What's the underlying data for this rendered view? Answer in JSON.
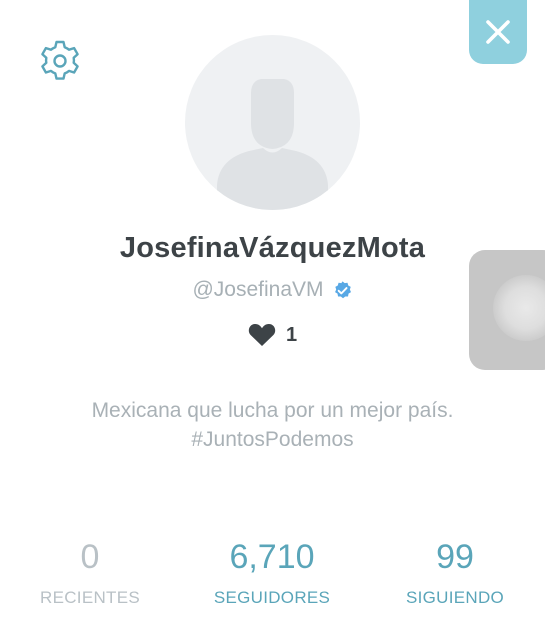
{
  "profile": {
    "display_name": "JosefinaVázquezMota",
    "handle": "@JosefinaVM",
    "likes_count": "1",
    "bio": "Mexicana que lucha por un mejor país. #JuntosPodemos"
  },
  "stats": [
    {
      "value": "0",
      "label": "RECIENTES"
    },
    {
      "value": "6,710",
      "label": "SEGUIDORES"
    },
    {
      "value": "99",
      "label": "SIGUIENDO"
    }
  ],
  "icons": {
    "settings": "gear-icon",
    "close": "close-icon",
    "verified": "verified-badge-icon",
    "likes": "heart-icon"
  },
  "colors": {
    "accent": "#5aa5b9",
    "close_bg": "#8fd0de",
    "verified": "#58a8e5",
    "name": "#3d4347",
    "muted": "#a9b1b6"
  }
}
